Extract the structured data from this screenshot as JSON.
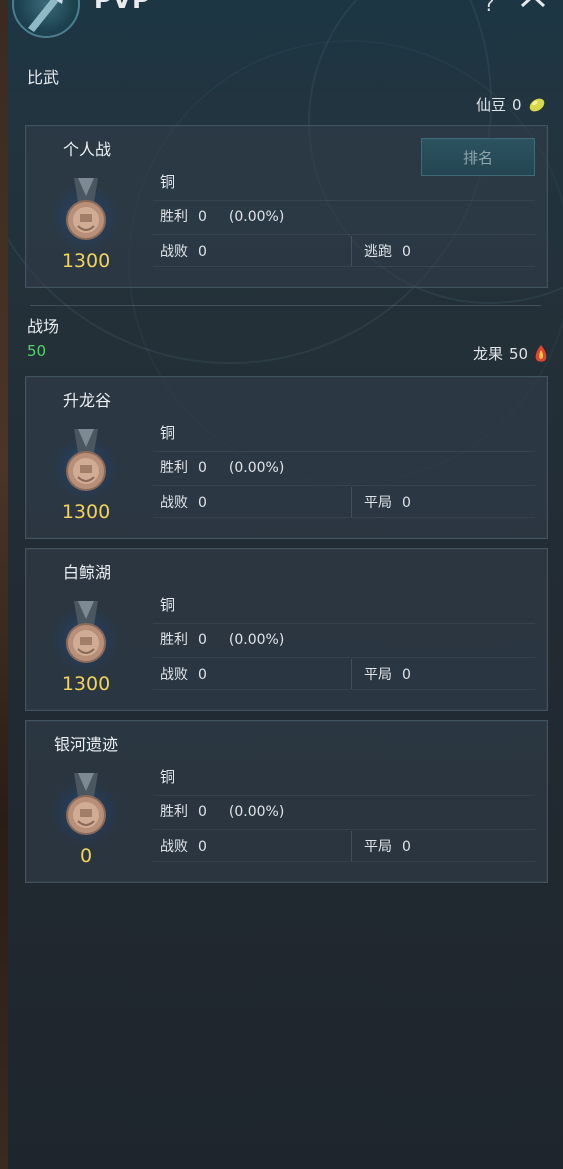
{
  "header": {
    "title": "PVP",
    "help_icon": "question-mark-icon",
    "close_icon": "close-icon"
  },
  "bi_wu": {
    "label": "比武",
    "currency": {
      "name": "仙豆",
      "value": "0",
      "icon": "bean-icon",
      "color": "#d8d84a"
    }
  },
  "personal": {
    "title": "个人战",
    "rank_button": "排名",
    "tier": "铜",
    "rating": "1300",
    "win_label": "胜利",
    "win": "0",
    "win_pct": "(0.00%)",
    "lose_label": "战败",
    "lose": "0",
    "extra_label": "逃跑",
    "extra": "0"
  },
  "battlefield": {
    "label": "战场",
    "points": "50",
    "currency": {
      "name": "龙果",
      "value": "50",
      "icon": "dragon-fruit-icon",
      "color": "#e0452f"
    }
  },
  "cards": [
    {
      "title": "升龙谷",
      "tier": "铜",
      "rating": "1300",
      "win_label": "胜利",
      "win": "0",
      "win_pct": "(0.00%)",
      "lose_label": "战败",
      "lose": "0",
      "extra_label": "平局",
      "extra": "0"
    },
    {
      "title": "白鲸湖",
      "tier": "铜",
      "rating": "1300",
      "win_label": "胜利",
      "win": "0",
      "win_pct": "(0.00%)",
      "lose_label": "战败",
      "lose": "0",
      "extra_label": "平局",
      "extra": "0"
    },
    {
      "title": "银河遗迹",
      "tier": "铜",
      "rating": "0",
      "win_label": "胜利",
      "win": "0",
      "win_pct": "(0.00%)",
      "lose_label": "战败",
      "lose": "0",
      "extra_label": "平局",
      "extra": "0"
    }
  ],
  "colors": {
    "rating": "#f1d35c",
    "points": "#4fd36b",
    "medal": "#c9a48c"
  }
}
